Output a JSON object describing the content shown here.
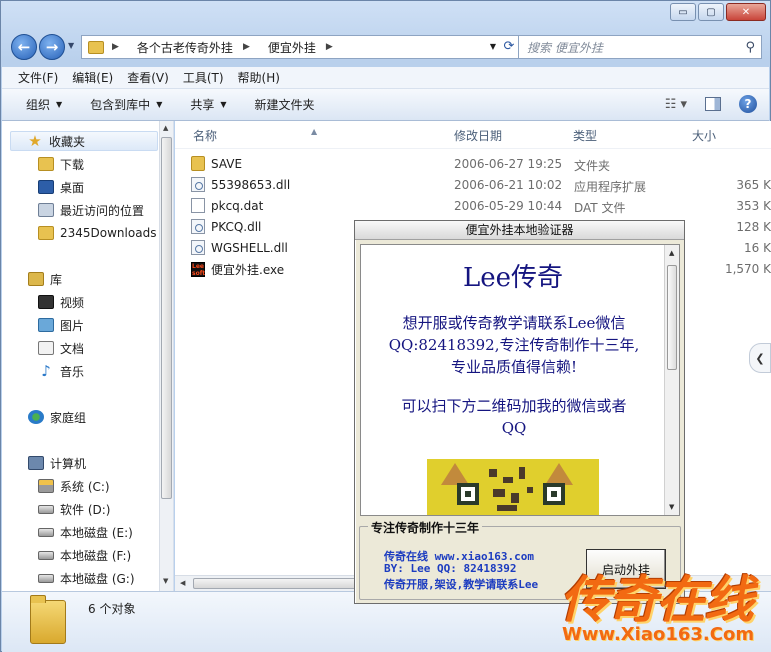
{
  "window": {
    "minimize_glyph": "▭",
    "maximize_glyph": "▢",
    "close_glyph": "✕"
  },
  "address": {
    "crumbs": [
      "各个古老传奇外挂",
      "便宜外挂"
    ],
    "search_placeholder": "搜索 便宜外挂"
  },
  "menu": [
    "文件(F)",
    "编辑(E)",
    "查看(V)",
    "工具(T)",
    "帮助(H)"
  ],
  "toolbar": {
    "organize": "组织",
    "include_library": "包含到库中",
    "share": "共享",
    "new_folder": "新建文件夹"
  },
  "sidebar": {
    "favorites": "收藏夹",
    "fav_items": [
      "下载",
      "桌面",
      "最近访问的位置",
      "2345Downloads"
    ],
    "libraries": "库",
    "lib_items": [
      "视频",
      "图片",
      "文档",
      "音乐"
    ],
    "homegroup": "家庭组",
    "computer": "计算机",
    "drives": [
      "系统 (C:)",
      "软件 (D:)",
      "本地磁盘 (E:)",
      "本地磁盘 (F:)",
      "本地磁盘 (G:)"
    ]
  },
  "columns": {
    "name": "名称",
    "date": "修改日期",
    "type": "类型",
    "size": "大小"
  },
  "files": [
    {
      "name": "SAVE",
      "date": "2006-06-27 19:25",
      "type": "文件夹",
      "size": "",
      "icon": "folder"
    },
    {
      "name": "55398653.dll",
      "date": "2006-06-21 10:02",
      "type": "应用程序扩展",
      "size": "365 K",
      "icon": "dll"
    },
    {
      "name": "pkcq.dat",
      "date": "2006-05-29 10:44",
      "type": "DAT 文件",
      "size": "353 K",
      "icon": "blank"
    },
    {
      "name": "PKCQ.dll",
      "date": "",
      "type": "",
      "size": "128 K",
      "icon": "dll"
    },
    {
      "name": "WGSHELL.dll",
      "date": "",
      "type": "",
      "size": "16 K",
      "icon": "dll"
    },
    {
      "name": "便宜外挂.exe",
      "date": "",
      "type": "",
      "size": "1,570 K",
      "icon": "exe"
    }
  ],
  "exe_icon_text": "Lee soft",
  "status": {
    "count": "6 个对象"
  },
  "dialog": {
    "title": "便宜外挂本地验证器",
    "heading": "Lee传奇",
    "para1": [
      "想开服或传奇教学请联系Lee微信",
      "QQ:82418392,专注传奇制作十三年,",
      "专业品质值得信赖!"
    ],
    "para2": [
      "可以扫下方二维码加我的微信或者",
      "QQ"
    ],
    "group_label": "专注传奇制作十三年",
    "ad_lines": [
      "传奇在线 www.xiao163.com",
      "BY: Lee QQ: 82418392",
      "传奇开服,架设,教学请联系Lee"
    ],
    "launch_button": "启动外挂"
  },
  "watermark": {
    "big": "传奇在线",
    "url": "Www.Xiao163.Com"
  }
}
